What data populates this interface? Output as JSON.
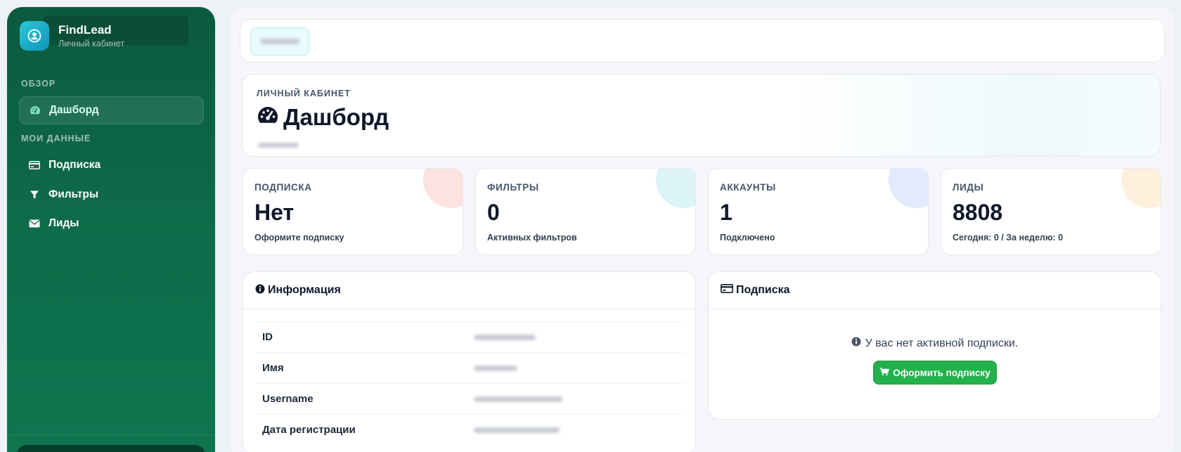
{
  "brand": {
    "title": "FindLead",
    "subtitle": "Личный кабинет"
  },
  "sidebar": {
    "sections": [
      {
        "label": "ОБЗОР"
      },
      {
        "label": "МОИ ДАННЫЕ"
      }
    ],
    "items": [
      {
        "label": "Дашборд",
        "icon": "gauge-icon",
        "active": true
      },
      {
        "label": "Подписка",
        "icon": "credit-card-icon"
      },
      {
        "label": "Фильтры",
        "icon": "filter-icon"
      },
      {
        "label": "Лиды",
        "icon": "envelope-icon"
      }
    ]
  },
  "hero": {
    "kicker": "ЛИЧНЫЙ КАБИНЕТ",
    "title": "Дашборд",
    "icon": "gauge-icon"
  },
  "stats": [
    {
      "label": "ПОДПИСКА",
      "value": "Нет",
      "sub": "Оформите подписку",
      "accent": "#fde2e0"
    },
    {
      "label": "ФИЛЬТРЫ",
      "value": "0",
      "sub": "Активных фильтров",
      "accent": "#dcf4f7"
    },
    {
      "label": "АККАУНТЫ",
      "value": "1",
      "sub": "Подключено",
      "accent": "#e1ebfd"
    },
    {
      "label": "ЛИДЫ",
      "value": "8808",
      "sub": "Сегодня: 0 / За неделю: 0",
      "accent": "#fdf1dd"
    }
  ],
  "info_panel": {
    "title": "Информация",
    "icon": "info-circle-icon",
    "rows": [
      {
        "key": "ID"
      },
      {
        "key": "Имя"
      },
      {
        "key": "Username"
      },
      {
        "key": "Дата регистрации"
      }
    ]
  },
  "subscription_panel": {
    "title": "Подписка",
    "icon": "credit-card-icon",
    "empty_text": "У вас нет активной подписки.",
    "button_label": "Оформить подписку",
    "button_icon": "cart-icon"
  },
  "colors": {
    "sidebar": "#0e6b49",
    "accent_green": "#22b14c",
    "text": "#0f172a"
  }
}
